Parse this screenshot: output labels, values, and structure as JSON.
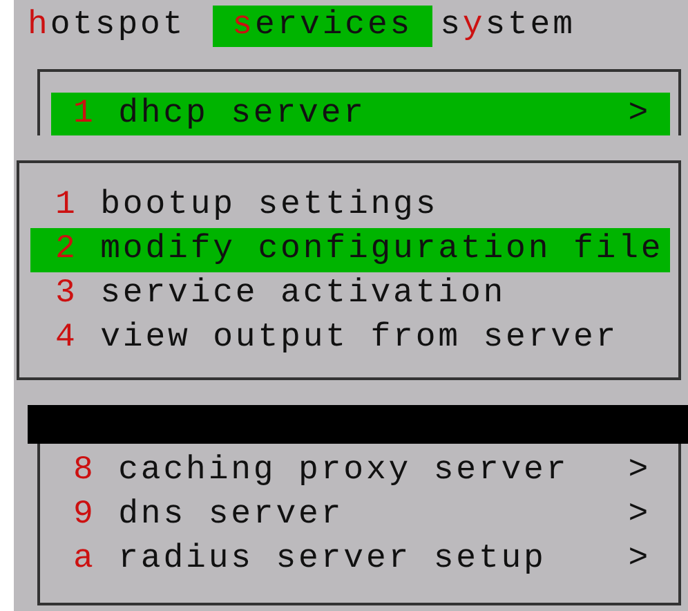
{
  "menubar": [
    {
      "key": "h",
      "post": "otspot",
      "selected": false
    },
    {
      "key": "s",
      "post": "ervices",
      "selected": true
    },
    {
      "pre": "s",
      "key": "y",
      "post": "stem",
      "selected": false
    }
  ],
  "services_menu": {
    "items": [
      {
        "key": "1",
        "label": "dhcp server",
        "arrow": ">",
        "selected": true
      }
    ]
  },
  "dhcp_submenu": {
    "items": [
      {
        "key": "1",
        "label": "bootup settings",
        "selected": false
      },
      {
        "key": "2",
        "label": "modify configuration file",
        "selected": true
      },
      {
        "key": "3",
        "label": "service activation",
        "selected": false
      },
      {
        "key": "4",
        "label": "view output from server",
        "selected": false
      }
    ]
  },
  "lower_menu": {
    "items": [
      {
        "key": "8",
        "label": "caching proxy server",
        "arrow": ">",
        "selected": false
      },
      {
        "key": "9",
        "label": "dns server",
        "arrow": ">",
        "selected": false
      },
      {
        "key": "a",
        "label": "radius server setup",
        "arrow": ">",
        "selected": false
      }
    ]
  }
}
